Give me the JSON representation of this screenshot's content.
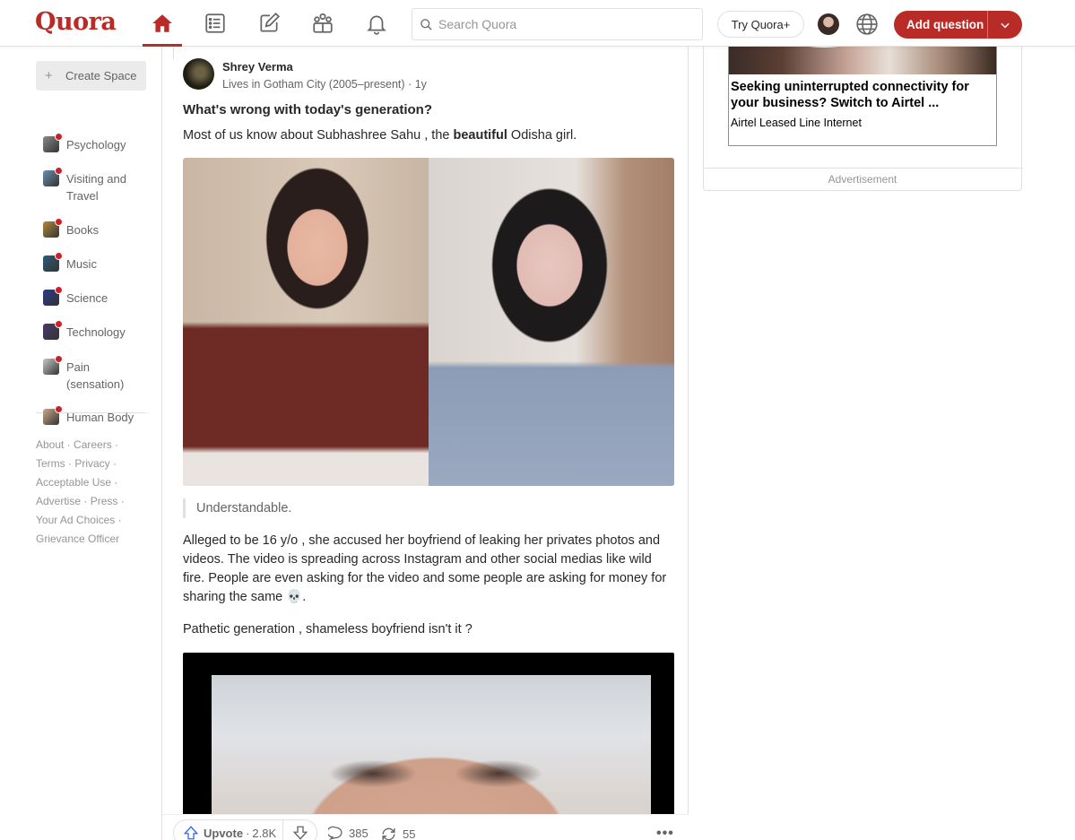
{
  "header": {
    "logo": "Quora",
    "search_placeholder": "Search Quora",
    "try_plus": "Try Quora+",
    "add_question": "Add question",
    "brand_color": "#b92b27",
    "nav_icons": [
      "home-icon",
      "following-icon",
      "answer-icon",
      "spaces-icon",
      "notifications-icon"
    ]
  },
  "sidebar": {
    "create_space": "Create Space",
    "topics": [
      {
        "label": "Psychology",
        "icon_color": "#8a8a8a"
      },
      {
        "label": "Visiting and Travel",
        "icon_color": "#6b8fb0"
      },
      {
        "label": "Books",
        "icon_color": "#b08a3a"
      },
      {
        "label": "Music",
        "icon_color": "#2b5d7a"
      },
      {
        "label": "Science",
        "icon_color": "#2a3a8a"
      },
      {
        "label": "Technology",
        "icon_color": "#4a3a6a"
      },
      {
        "label": "Pain (sensation)",
        "icon_color": "#c8c8c8"
      },
      {
        "label": "Human Body",
        "icon_color": "#c9a98a"
      }
    ],
    "footer_links": [
      [
        "About",
        "Careers"
      ],
      [
        "Terms",
        "Privacy"
      ],
      [
        "Acceptable Use"
      ],
      [
        "Advertise",
        "Press"
      ],
      [
        "Your Ad Choices"
      ],
      [
        "Grievance Officer"
      ]
    ]
  },
  "post": {
    "author_name": "Shrey Verma",
    "author_credential": "Lives in Gotham City (2005–present)",
    "time": "1y",
    "question": "What's wrong with today's generation?",
    "intro_before": "Most of us know about Subhashree Sahu , the ",
    "intro_bold": "beautiful",
    "intro_after": " Odisha girl.",
    "quote": "Understandable.",
    "paragraph2": "Alleged to be 16 y/o , she accused her boyfriend of leaking her privates photos and videos. The video is spreading across Instagram and other social medias like wild fire. People are even asking for the video and some people are asking for money for sharing the same 💀.",
    "paragraph3": "Pathetic generation , shameless boyfriend isn't it ?"
  },
  "actions": {
    "upvote_label": "Upvote",
    "upvote_count": "2.8K",
    "comments": "385",
    "shares": "55"
  },
  "ad": {
    "headline": "Seeking uninterrupted connectivity for your business? Switch to Airtel ...",
    "subtext": "Airtel Leased Line Internet",
    "label": "Advertisement"
  }
}
